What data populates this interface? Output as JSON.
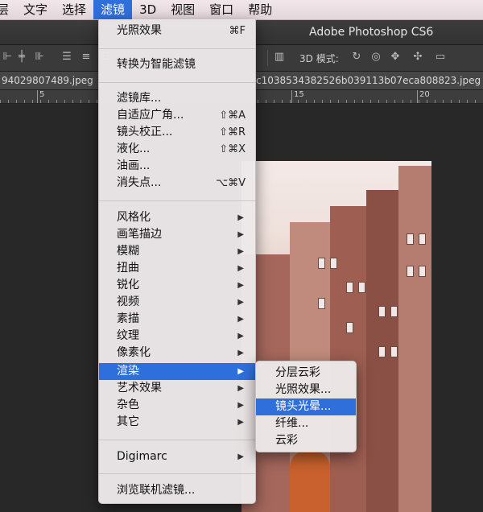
{
  "menubar": {
    "items": [
      {
        "label": "层"
      },
      {
        "label": "文字"
      },
      {
        "label": "选择"
      },
      {
        "label": "滤镜",
        "active": true
      },
      {
        "label": "3D"
      },
      {
        "label": "视图"
      },
      {
        "label": "窗口"
      },
      {
        "label": "帮助"
      }
    ]
  },
  "titlebar": {
    "title": "Adobe Photoshop CS6"
  },
  "options": {
    "mode_label": "3D 模式:"
  },
  "tabs": {
    "left": "94029807489.jpeg",
    "right": "c1038534382526b039113b07eca808823.jpeg"
  },
  "ruler": {
    "marks": [
      "5",
      "15",
      "20"
    ]
  },
  "filter_menu": {
    "items": [
      {
        "label": "光照效果",
        "shortcut": "⌘F"
      },
      {
        "label": "转换为智能滤镜"
      },
      {
        "label": "滤镜库..."
      },
      {
        "label": "自适应广角...",
        "shortcut": "⇧⌘A"
      },
      {
        "label": "镜头校正...",
        "shortcut": "⇧⌘R"
      },
      {
        "label": "液化...",
        "shortcut": "⇧⌘X"
      },
      {
        "label": "油画..."
      },
      {
        "label": "消失点...",
        "shortcut": "⌥⌘V"
      },
      {
        "label": "风格化",
        "submenu": true
      },
      {
        "label": "画笔描边",
        "submenu": true
      },
      {
        "label": "模糊",
        "submenu": true
      },
      {
        "label": "扭曲",
        "submenu": true
      },
      {
        "label": "锐化",
        "submenu": true
      },
      {
        "label": "视频",
        "submenu": true
      },
      {
        "label": "素描",
        "submenu": true
      },
      {
        "label": "纹理",
        "submenu": true
      },
      {
        "label": "像素化",
        "submenu": true
      },
      {
        "label": "渲染",
        "submenu": true,
        "highlighted": true
      },
      {
        "label": "艺术效果",
        "submenu": true
      },
      {
        "label": "杂色",
        "submenu": true
      },
      {
        "label": "其它",
        "submenu": true
      },
      {
        "label": "Digimarc",
        "submenu": true
      },
      {
        "label": "浏览联机滤镜..."
      }
    ]
  },
  "render_submenu": {
    "items": [
      {
        "label": "分层云彩"
      },
      {
        "label": "光照效果..."
      },
      {
        "label": "镜头光晕...",
        "highlighted": true
      },
      {
        "label": "纤维..."
      },
      {
        "label": "云彩"
      }
    ]
  },
  "colors": {
    "highlight": "#2f6fdc",
    "menu_bg": "#ece8e9",
    "workspace": "#282828"
  }
}
